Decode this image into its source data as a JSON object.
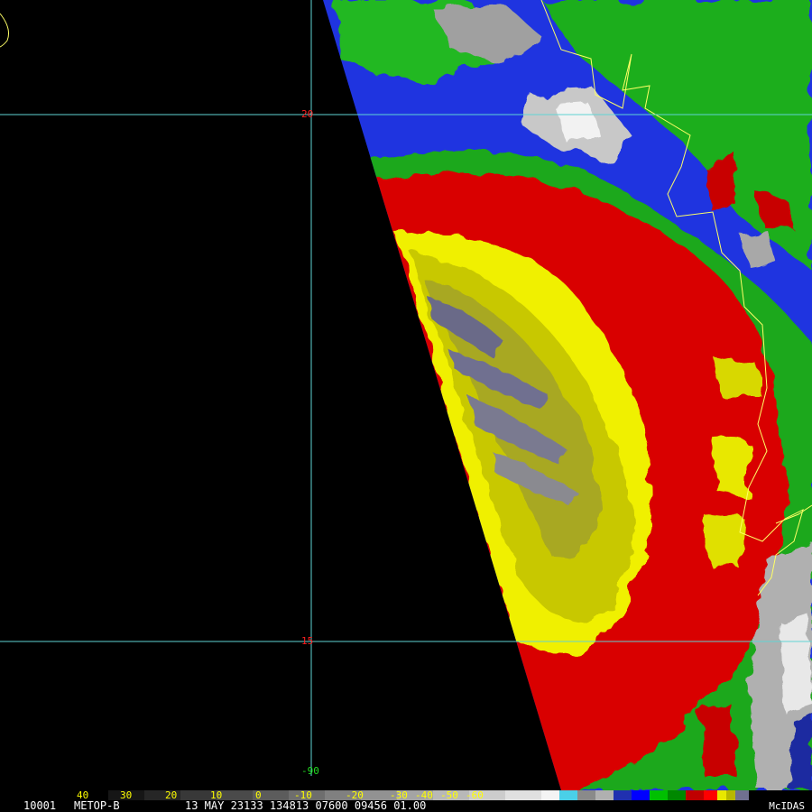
{
  "image": {
    "satellite": "METOP-B",
    "frame_id": "10001",
    "datetime_fields": "13 MAY 23133 134813 07600 09456 01.00",
    "brand": "McIDAS"
  },
  "grid": {
    "lat_labels": [
      "20",
      "15"
    ],
    "lon_label": "-90"
  },
  "colorbar": {
    "labels": [
      "40",
      "30",
      "20",
      "10",
      "0",
      "-10",
      "-20",
      "-30",
      "-40",
      "-50",
      "-60"
    ]
  },
  "colors": {
    "grid_line": "#5fd3d3",
    "coastline": "#ffff66",
    "label_red": "#ff2020",
    "label_green": "#22dd22",
    "label_yellow": "#ffff00",
    "text_white": "#ffffff"
  }
}
